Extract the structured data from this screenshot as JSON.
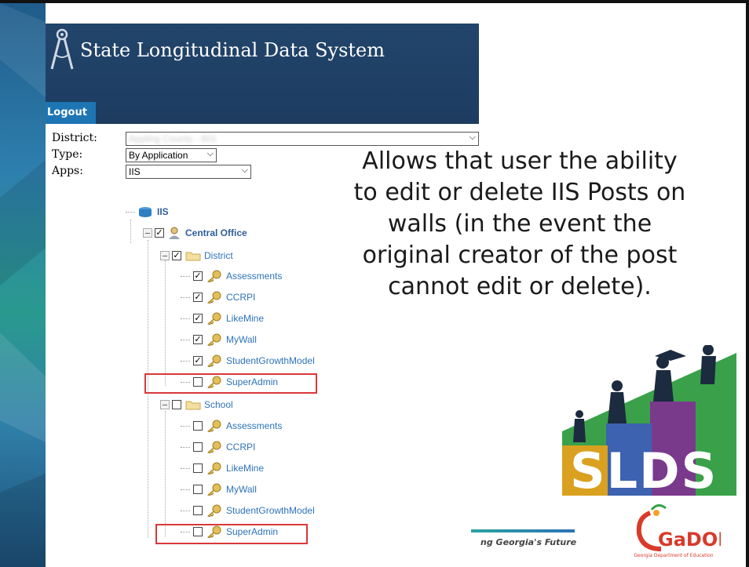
{
  "app": {
    "title": "State Longitudinal Data System",
    "logout_label": "Logout"
  },
  "form": {
    "district_label": "District:",
    "district_value": "Appling County - 601",
    "type_label": "Type:",
    "type_value": "By Application",
    "apps_label": "Apps:",
    "apps_value": "IIS"
  },
  "tree": {
    "root": "IIS",
    "central_office": "Central Office",
    "district_group": {
      "label": "District",
      "items": [
        {
          "label": "Assessments",
          "checked": true
        },
        {
          "label": "CCRPI",
          "checked": true
        },
        {
          "label": "LikeMine",
          "checked": true
        },
        {
          "label": "MyWall",
          "checked": true
        },
        {
          "label": "StudentGrowthModel",
          "checked": true
        },
        {
          "label": "SuperAdmin",
          "checked": false
        }
      ]
    },
    "school_group": {
      "label": "School",
      "items": [
        {
          "label": "Assessments",
          "checked": false
        },
        {
          "label": "CCRPI",
          "checked": false
        },
        {
          "label": "LikeMine",
          "checked": false
        },
        {
          "label": "MyWall",
          "checked": false
        },
        {
          "label": "StudentGrowthModel",
          "checked": false
        },
        {
          "label": "SuperAdmin",
          "checked": false
        }
      ]
    }
  },
  "callout": {
    "lines": [
      "Allows that user the ability",
      "to edit or delete IIS Posts on",
      "walls (in the event the",
      "original creator of the post",
      "cannot edit or delete)."
    ]
  },
  "footer": {
    "tagline": "ng Georgia's Future"
  },
  "logos": {
    "slds_text": "SLDS",
    "gadoe_text": "GaDOE",
    "gadoe_subtext": "Georgia Department of Education"
  },
  "colors": {
    "header_bg": "#1d3c60",
    "logout_bg": "#1e75b4",
    "highlight_red": "#d9383a",
    "tree_link": "#2d73b8"
  }
}
